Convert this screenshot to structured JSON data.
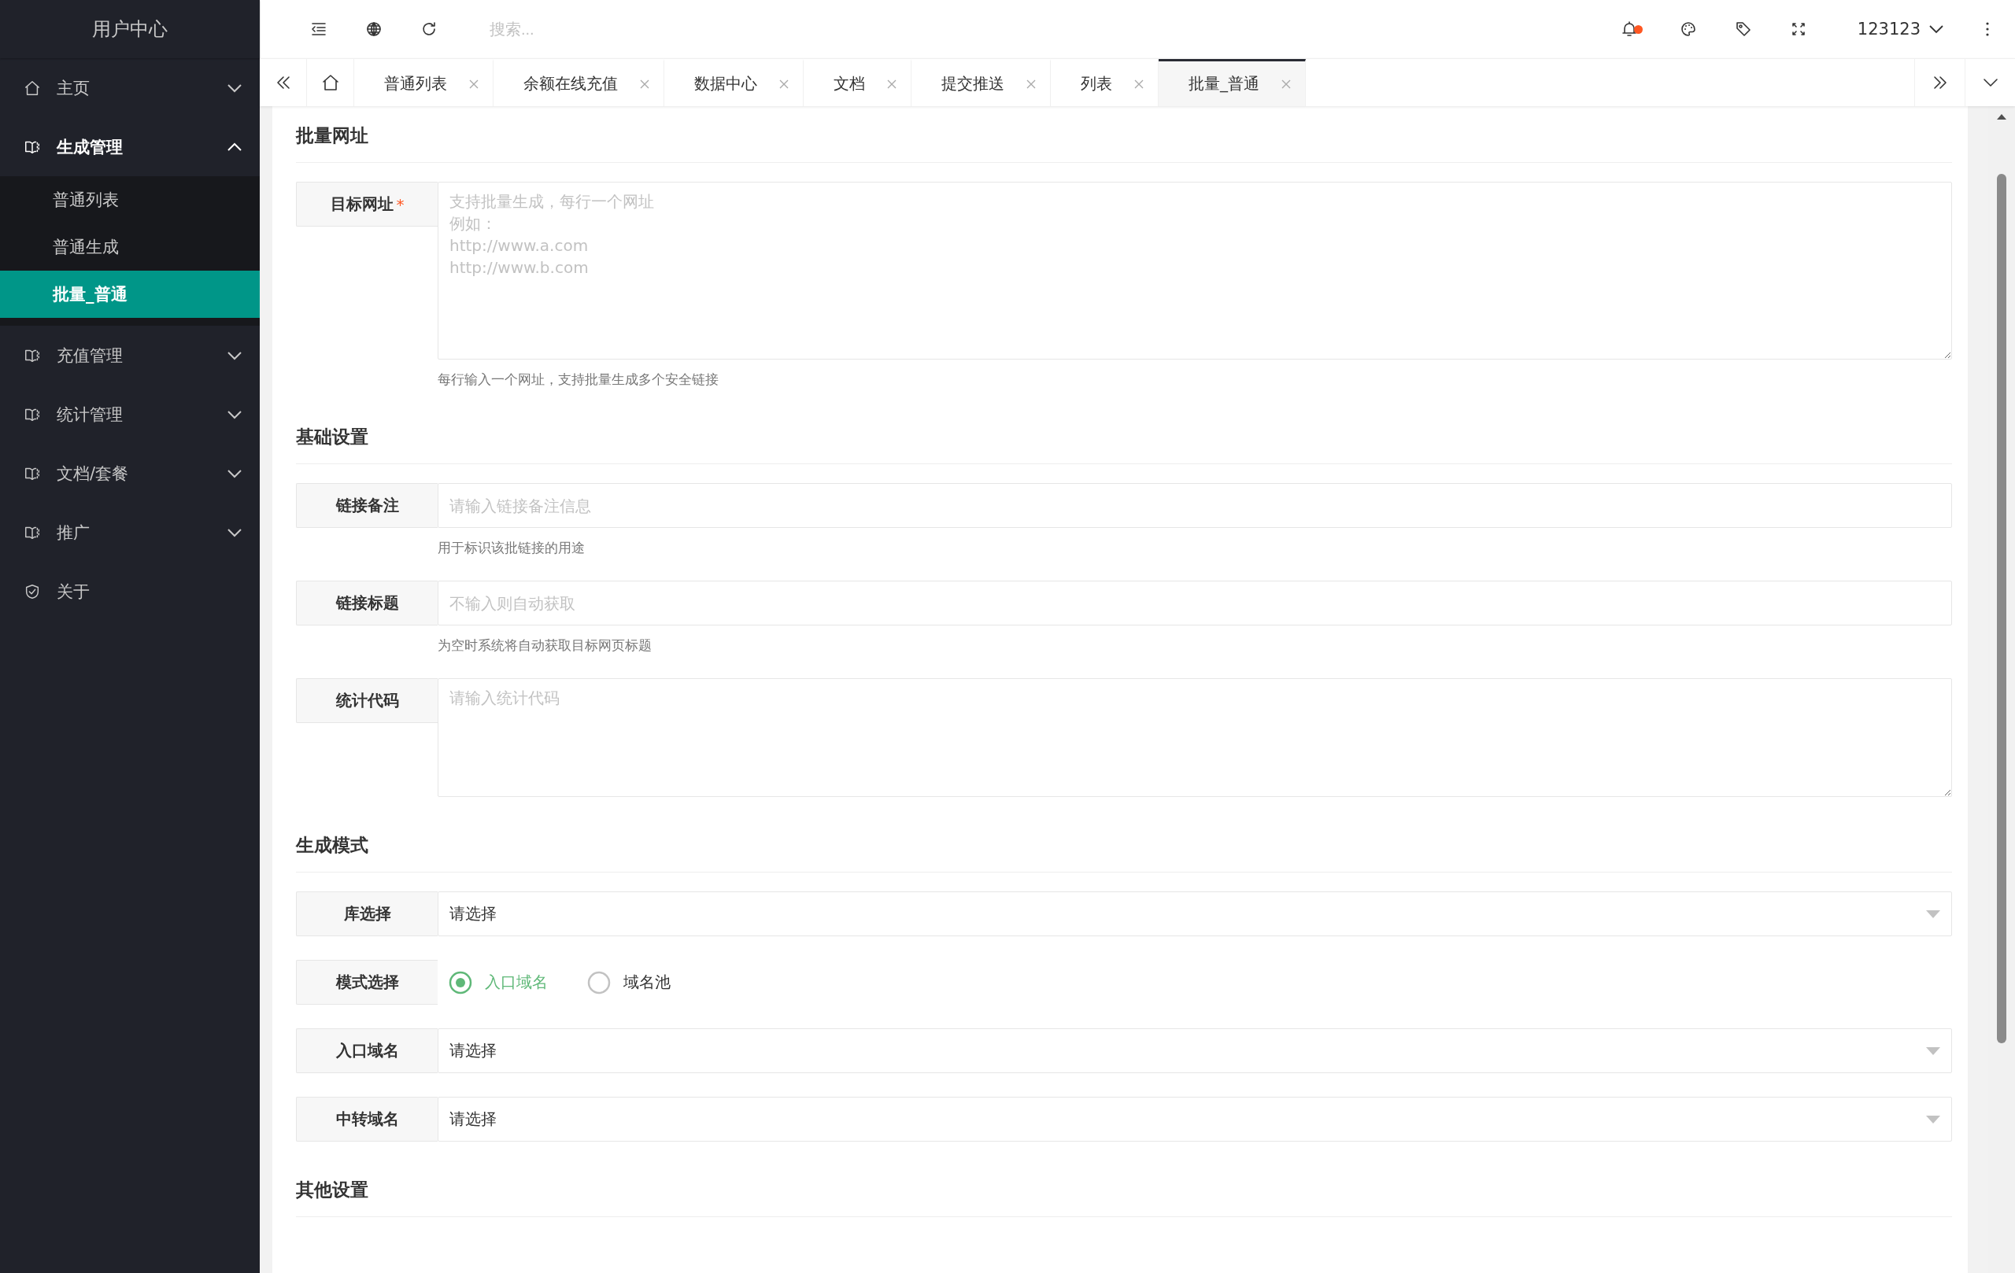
{
  "sidebar": {
    "title": "用户中心",
    "items": [
      {
        "kind": "group",
        "label": "主页",
        "expanded": false
      },
      {
        "kind": "group",
        "label": "生成管理",
        "expanded": true,
        "children": [
          {
            "label": "普通列表",
            "selected": false
          },
          {
            "label": "普通生成",
            "selected": false
          },
          {
            "label": "批量_普通",
            "selected": true
          }
        ]
      },
      {
        "kind": "group",
        "label": "充值管理",
        "expanded": false
      },
      {
        "kind": "group",
        "label": "统计管理",
        "expanded": false
      },
      {
        "kind": "group",
        "label": "文档/套餐",
        "expanded": false
      },
      {
        "kind": "group",
        "label": "推广",
        "expanded": false
      },
      {
        "kind": "link",
        "label": "关于"
      }
    ]
  },
  "header": {
    "search": {
      "placeholder": "搜索..."
    },
    "notification": true,
    "user": "123123"
  },
  "tabs": [
    {
      "label": "普通列表",
      "selected": false
    },
    {
      "label": "余额在线充值",
      "selected": false
    },
    {
      "label": "数据中心",
      "selected": false
    },
    {
      "label": "文档",
      "selected": false
    },
    {
      "label": "提交推送",
      "selected": false
    },
    {
      "label": "列表",
      "selected": false
    },
    {
      "label": "批量_普通",
      "selected": true
    }
  ],
  "sections": [
    {
      "title": "批量网址",
      "fields": [
        {
          "kind": "textarea",
          "label": "目标网址",
          "required_mark": "*",
          "placeholder_lines": [
            "支持批量生成，每行一个网址",
            "例如：",
            "http://www.a.com",
            "http://www.b.com"
          ],
          "help": "每行输入一个网址，支持批量生成多个安全链接"
        }
      ]
    },
    {
      "title": "基础设置",
      "fields": [
        {
          "kind": "input",
          "label": "链接备注",
          "placeholder": "请输入链接备注信息",
          "help": "用于标识该批链接的用途"
        },
        {
          "kind": "input",
          "label": "链接标题",
          "placeholder": "不输入则自动获取",
          "help": "为空时系统将自动获取目标网页标题"
        },
        {
          "kind": "textarea",
          "label": "统计代码",
          "placeholder_lines": [
            "请输入统计代码"
          ]
        }
      ]
    },
    {
      "title": "生成模式",
      "fields": [
        {
          "kind": "select",
          "label": "库选择",
          "value": "请选择"
        },
        {
          "kind": "radio",
          "label": "模式选择",
          "options": [
            {
              "label": "入口域名",
              "selected": true
            },
            {
              "label": "域名池",
              "selected": false
            }
          ]
        },
        {
          "kind": "select",
          "label": "入口域名",
          "value": "请选择"
        },
        {
          "kind": "select",
          "label": "中转域名",
          "value": "请选择"
        }
      ]
    },
    {
      "title": "其他设置"
    }
  ]
}
